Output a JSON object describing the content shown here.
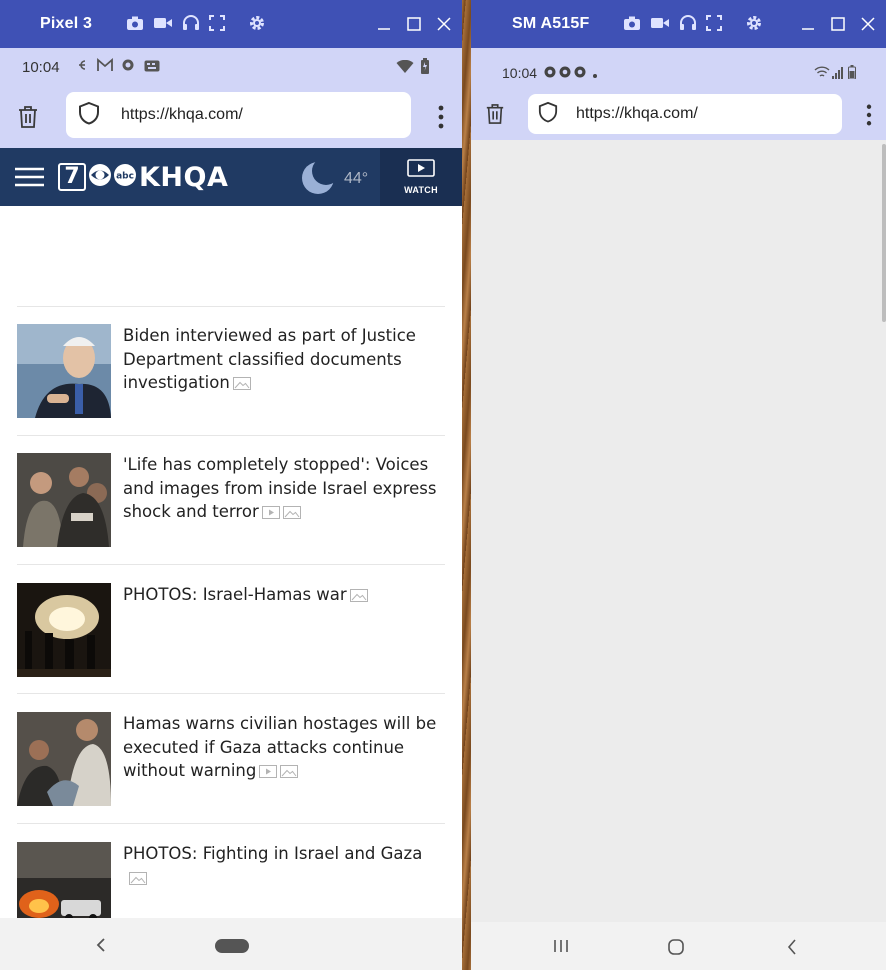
{
  "left_device": {
    "window_title": "Pixel 3",
    "status_time": "10:04",
    "url": "https://khqa.com/",
    "site": {
      "channel_number": "7",
      "station_name": "KHQA",
      "temperature": "44°",
      "watch_label": "WATCH"
    },
    "stories": [
      {
        "title": "Biden interviewed as part of Justice Department classified documents investigation",
        "icons": [
          "gallery-icon"
        ]
      },
      {
        "title": "'Life has completely stopped': Voices and images from inside Israel express shock and terror",
        "icons": [
          "video-icon",
          "gallery-icon"
        ]
      },
      {
        "title": "PHOTOS: Israel-Hamas war",
        "icons": [
          "gallery-icon"
        ]
      },
      {
        "title": "Hamas warns civilian hostages will be executed if Gaza attacks continue without warning",
        "icons": [
          "video-icon",
          "gallery-icon"
        ]
      },
      {
        "title": "PHOTOS: Fighting in Israel and Gaza",
        "icons": [
          "gallery-icon"
        ]
      }
    ]
  },
  "right_device": {
    "window_title": "SM A515F",
    "status_time": "10:04",
    "url": "https://khqa.com/"
  },
  "colors": {
    "title_bar": "#3f51b5",
    "browser_chrome": "#d1d5f7",
    "site_header": "#203a63",
    "empty_page": "#ececec"
  }
}
